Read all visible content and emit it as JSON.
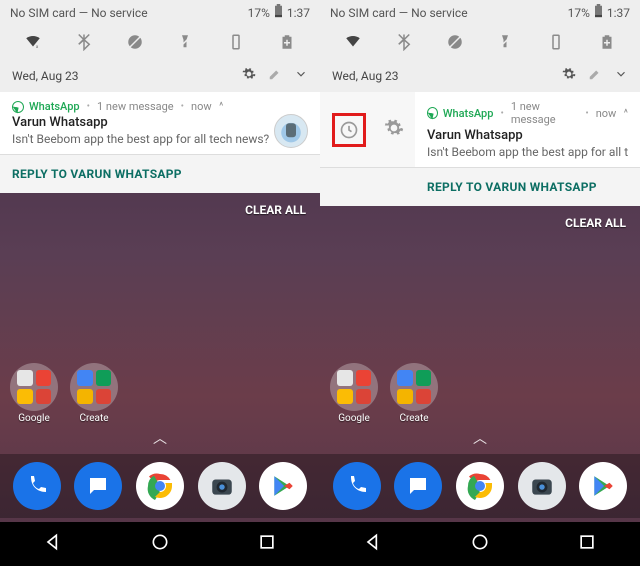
{
  "status": {
    "sim": "No SIM card — No service",
    "battery": "17%",
    "time": "1:37"
  },
  "date": "Wed, Aug 23",
  "notification": {
    "app": "WhatsApp",
    "meta1": "1 new message",
    "meta2": "now",
    "title": "Varun Whatsapp",
    "text": "Isn't Beebom app the best app for all tech news?",
    "text_clipped": "Isn't Beebom app the best app for all tech n"
  },
  "reply_label": "REPLY TO VARUN WHATSAPP",
  "clear_all": "CLEAR ALL",
  "folders": {
    "f1": "Google",
    "f2": "Create"
  },
  "colors": {
    "whatsapp": "#1fa855",
    "teal": "#0c6e63",
    "highlight": "#e11b1b"
  }
}
